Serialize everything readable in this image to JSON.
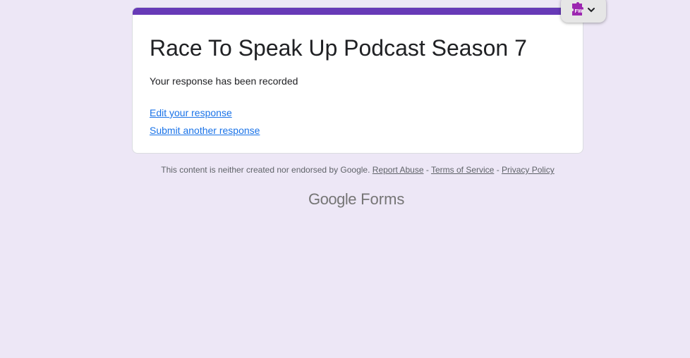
{
  "form": {
    "title": "Race To Speak Up Podcast Season 7",
    "confirmation_message": "Your response has been recorded",
    "edit_response_link": "Edit your response",
    "submit_another_link": "Submit another response",
    "accent_color": "#673ab7"
  },
  "footer": {
    "disclaimer": "This content is neither created nor endorsed by Google.",
    "report_abuse": "Report Abuse",
    "separator": "-",
    "terms": "Terms of Service",
    "privacy": "Privacy Policy",
    "logo_google": "Google",
    "logo_forms": "Forms"
  },
  "extension_widget": {
    "badge_text": "FW",
    "icon": "puzzle-icon",
    "chevron_icon": "chevron-down-icon"
  }
}
